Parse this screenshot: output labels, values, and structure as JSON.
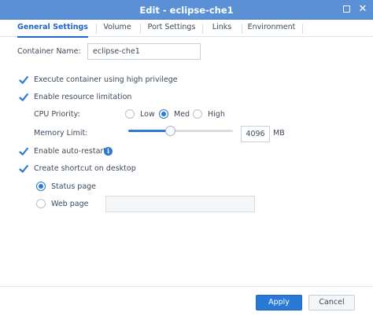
{
  "window": {
    "title": "Edit - eclipse-che1",
    "colors": {
      "titlebar": "#5b8fd6",
      "accent": "#1f66c9"
    }
  },
  "tabs": [
    {
      "label": "General Settings",
      "active": true
    },
    {
      "label": "Volume",
      "active": false
    },
    {
      "label": "Port Settings",
      "active": false
    },
    {
      "label": "Links",
      "active": false
    },
    {
      "label": "Environment",
      "active": false
    }
  ],
  "form": {
    "container_name_label": "Container Name:",
    "container_name_value": "eclipse-che1",
    "high_privilege": {
      "label": "Execute container using high privilege",
      "checked": true
    },
    "resource_limitation": {
      "label": "Enable resource limitation",
      "checked": true
    },
    "cpu_priority": {
      "label": "CPU Priority:",
      "options": [
        "Low",
        "Med",
        "High"
      ],
      "selected": "Med"
    },
    "memory_limit": {
      "label": "Memory Limit:",
      "value": "4096",
      "unit": "MB",
      "slider_fraction": 0.4
    },
    "auto_restart": {
      "label": "Enable auto-restart",
      "checked": true,
      "info_icon": "info-icon"
    },
    "shortcut": {
      "label": "Create shortcut on desktop",
      "checked": true,
      "options": [
        "Status page",
        "Web page"
      ],
      "selected": "Status page",
      "web_page_value": ""
    }
  },
  "footer": {
    "apply_label": "Apply",
    "cancel_label": "Cancel"
  }
}
